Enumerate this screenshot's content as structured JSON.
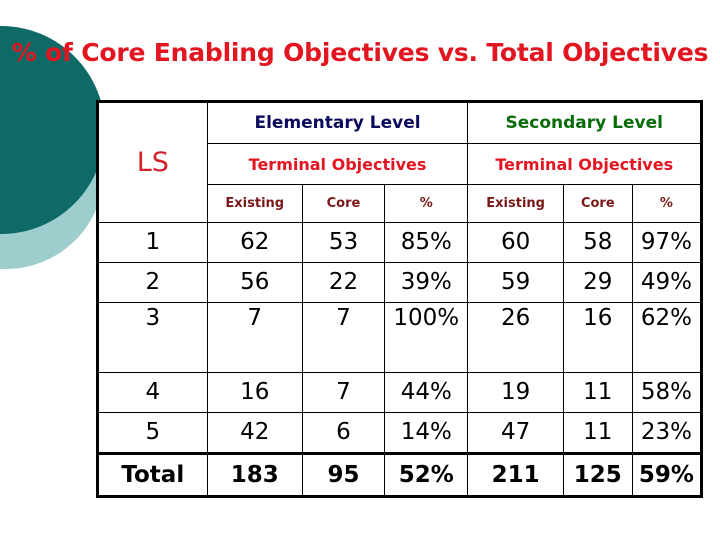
{
  "slide": {
    "title": "% of Core Enabling Objectives vs. Total Objectives",
    "colors": {
      "title_red": "#e31520",
      "deco_dark_teal": "#0d6a67",
      "deco_light_teal": "#9dcdcd",
      "elementary_navy": "#0a0a5c",
      "secondary_green": "#0a6b0a",
      "terminal_red": "#e31520",
      "subheader_maroon": "#7a1818",
      "background": "#ffffff"
    }
  },
  "decorations": [
    {
      "name": "light-teal-circle",
      "color": "#9dcdcd"
    },
    {
      "name": "dark-teal-circle",
      "color": "#0d6a67"
    }
  ],
  "table": {
    "corner_label": "LS",
    "group_headers": [
      {
        "label": "Elementary Level",
        "span": 3
      },
      {
        "label": "Secondary Level",
        "span": 3
      }
    ],
    "subgroup_headers": [
      {
        "label": "Terminal Objectives",
        "span": 3
      },
      {
        "label": "Terminal Objectives",
        "span": 3
      }
    ],
    "column_headers": [
      "Existing",
      "Core",
      "%",
      "Existing",
      "Core",
      "%"
    ],
    "rows": [
      {
        "ls": "1",
        "elem_existing": "62",
        "elem_core": "53",
        "elem_pct": "85%",
        "sec_existing": "60",
        "sec_core": "58",
        "sec_pct": "97%",
        "tall": false,
        "total": false
      },
      {
        "ls": "2",
        "elem_existing": "56",
        "elem_core": "22",
        "elem_pct": "39%",
        "sec_existing": "59",
        "sec_core": "29",
        "sec_pct": "49%",
        "tall": false,
        "total": false
      },
      {
        "ls": "3",
        "elem_existing": "7",
        "elem_core": "7",
        "elem_pct": "100%",
        "sec_existing": "26",
        "sec_core": "16",
        "sec_pct": "62%",
        "tall": true,
        "total": false
      },
      {
        "ls": "4",
        "elem_existing": "16",
        "elem_core": "7",
        "elem_pct": "44%",
        "sec_existing": "19",
        "sec_core": "11",
        "sec_pct": "58%",
        "tall": false,
        "total": false
      },
      {
        "ls": "5",
        "elem_existing": "42",
        "elem_core": "6",
        "elem_pct": "14%",
        "sec_existing": "47",
        "sec_core": "11",
        "sec_pct": "23%",
        "tall": false,
        "total": false
      },
      {
        "ls": "Total",
        "elem_existing": "183",
        "elem_core": "95",
        "elem_pct": "52%",
        "sec_existing": "211",
        "sec_core": "125",
        "sec_pct": "59%",
        "tall": false,
        "total": true
      }
    ]
  },
  "chart_data": {
    "type": "table",
    "title": "% of Core Enabling Objectives vs. Total Objectives",
    "categories": [
      "1",
      "2",
      "3",
      "4",
      "5",
      "Total"
    ],
    "columns": [
      "LS",
      "Elementary Level - Terminal Objectives - Existing",
      "Elementary Level - Terminal Objectives - Core",
      "Elementary Level - Terminal Objectives - %",
      "Secondary Level - Terminal Objectives - Existing",
      "Secondary Level - Terminal Objectives - Core",
      "Secondary Level - Terminal Objectives - %"
    ],
    "series": [
      {
        "name": "Elementary Existing",
        "values": [
          62,
          56,
          7,
          16,
          42,
          183
        ]
      },
      {
        "name": "Elementary Core",
        "values": [
          53,
          22,
          7,
          7,
          6,
          95
        ]
      },
      {
        "name": "Elementary %",
        "values": [
          85,
          39,
          100,
          44,
          14,
          52
        ]
      },
      {
        "name": "Secondary Existing",
        "values": [
          60,
          59,
          26,
          19,
          47,
          211
        ]
      },
      {
        "name": "Secondary Core",
        "values": [
          58,
          29,
          16,
          11,
          11,
          125
        ]
      },
      {
        "name": "Secondary %",
        "values": [
          97,
          49,
          62,
          58,
          23,
          59
        ]
      }
    ],
    "xlabel": "LS",
    "ylabel": "",
    "grid": true,
    "legend": "none"
  }
}
